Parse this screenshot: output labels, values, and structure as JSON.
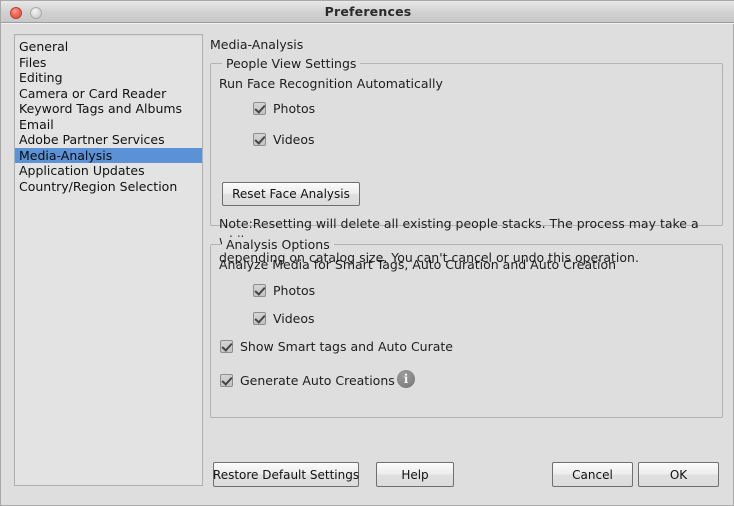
{
  "window": {
    "title": "Preferences",
    "close_button": "close",
    "minimize_button": "minimize",
    "accent_selection_color": "#5b92d6",
    "background_color": "#dedede"
  },
  "sidebar": {
    "items": [
      {
        "label": "General",
        "selected": false
      },
      {
        "label": "Files",
        "selected": false
      },
      {
        "label": "Editing",
        "selected": false
      },
      {
        "label": "Camera or Card Reader",
        "selected": false
      },
      {
        "label": "Keyword Tags and Albums",
        "selected": false
      },
      {
        "label": "Email",
        "selected": false
      },
      {
        "label": "Adobe Partner Services",
        "selected": false
      },
      {
        "label": "Media-Analysis",
        "selected": true
      },
      {
        "label": "Application Updates",
        "selected": false
      },
      {
        "label": "Country/Region Selection",
        "selected": false
      }
    ]
  },
  "panel": {
    "title": "Media-Analysis",
    "people_view": {
      "legend": "People View Settings",
      "subhead": "Run Face Recognition Automatically",
      "checkboxes": [
        {
          "label": "Photos",
          "checked": true
        },
        {
          "label": "Videos",
          "checked": true
        }
      ],
      "reset_button": "Reset Face Analysis",
      "note_line1": "Note:Resetting will delete all existing people stacks. The process may take a while",
      "note_line2": "depending on catalog size. You can't cancel or undo this operation."
    },
    "analysis_options": {
      "legend": "Analysis Options",
      "subhead": "Analyze Media for Smart Tags, Auto Curation and Auto Creation",
      "checkboxes": [
        {
          "label": "Photos",
          "checked": true
        },
        {
          "label": "Videos",
          "checked": true
        },
        {
          "label": "Show Smart tags and Auto Curate",
          "checked": true
        },
        {
          "label": "Generate Auto Creations",
          "checked": true
        }
      ],
      "info_icon_glyph": "i"
    }
  },
  "footer": {
    "restore_label": "Restore Default Settings",
    "help_label": "Help",
    "cancel_label": "Cancel",
    "ok_label": "OK"
  }
}
